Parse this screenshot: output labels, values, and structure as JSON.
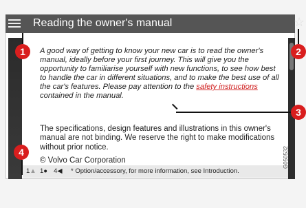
{
  "header": {
    "title": "Reading the owner's manual"
  },
  "icons": {
    "menu": "hamburger-menu-icon",
    "favorite": "star-icon",
    "favorite_glyph": "☆"
  },
  "body": {
    "paragraph1_before": "A good way of getting to know your new car is to read the owner's manual, ideally before your first journey. This will give you the opportunity to familiarise yourself with new functions, to see how best to handle the car in different situations, and to make the best use of all the car's features. Please pay attention to the ",
    "paragraph1_link": "safety instructions",
    "paragraph1_after": " contained in the manual.",
    "paragraph2": "The specifications, design features and illustrations in this owner's manual are not binding. We reserve the right to make modifications without prior notice.",
    "copyright": "© Volvo Car Corporation"
  },
  "footer": {
    "stat1": "1",
    "stat2": "1",
    "stat3": "4",
    "note": "* Option/accessory, for more information, see Introduction."
  },
  "side_code": "G050532",
  "callouts": [
    "1",
    "2",
    "3",
    "4"
  ],
  "colors": {
    "callout": "#d91e1e",
    "link": "#d02020",
    "titlebar": "#555555"
  }
}
